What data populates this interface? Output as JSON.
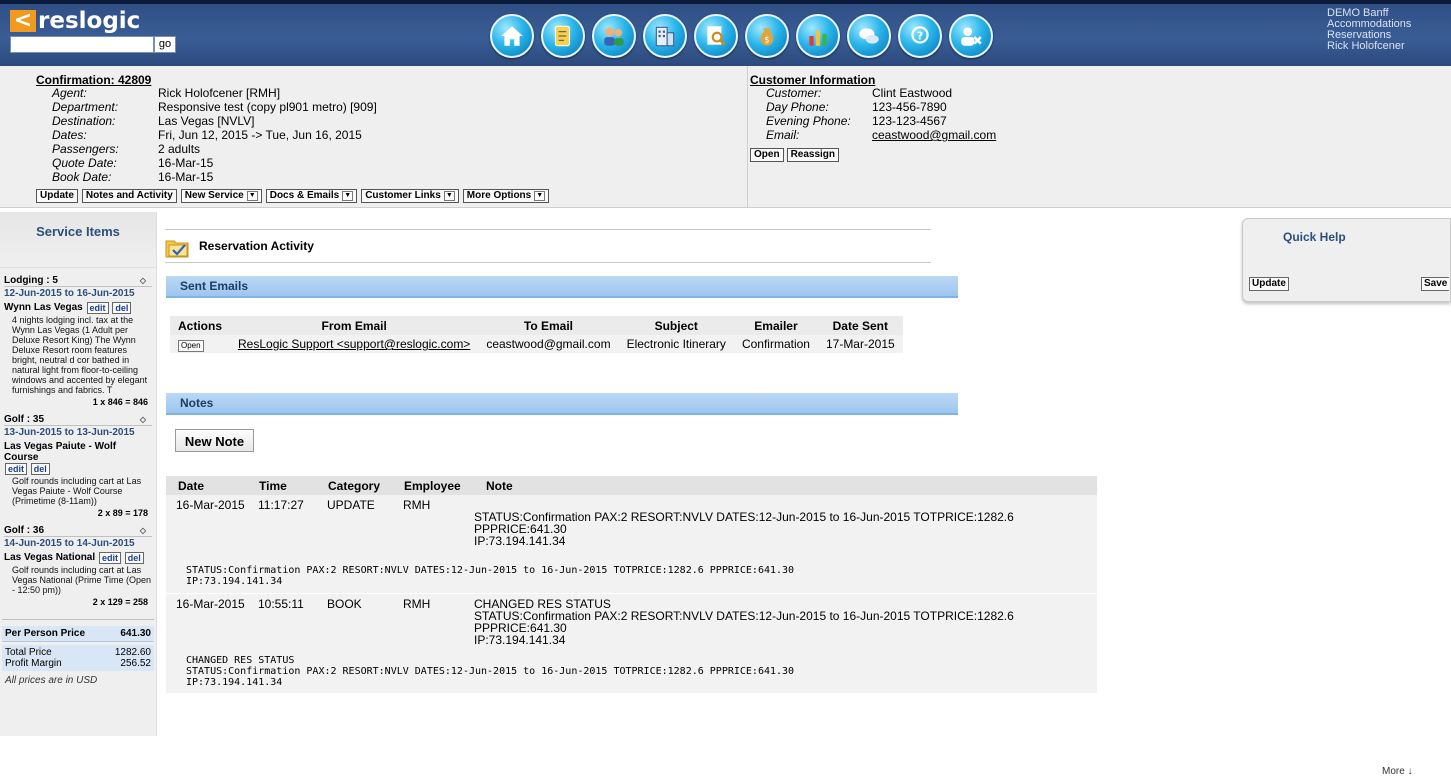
{
  "header": {
    "logo_text": "reslogic",
    "search_placeholder": "",
    "go_label": "go",
    "nav_icons": [
      "home-icon",
      "notes-icon",
      "customers-icon",
      "suppliers-icon",
      "search-icon",
      "money-icon",
      "reports-icon",
      "chat-icon",
      "help-icon",
      "logout-icon"
    ],
    "user_info": [
      "DEMO Banff",
      "Accommodations",
      "Reservations",
      "Rick Holofcener"
    ]
  },
  "confirmation": {
    "title": "Confirmation: 42809",
    "rows": [
      {
        "label": "Agent:",
        "value": "Rick Holofcener [RMH]"
      },
      {
        "label": "Department:",
        "value": "Responsive test (copy pl901 metro) [909]"
      },
      {
        "label": "Destination:",
        "value": "Las Vegas [NVLV]"
      },
      {
        "label": "Dates:",
        "value": "Fri, Jun 12, 2015 -> Tue, Jun 16, 2015"
      },
      {
        "label": "Passengers:",
        "value": "2 adults"
      },
      {
        "label": "Quote Date:",
        "value": "16-Mar-15"
      },
      {
        "label": "Book Date:",
        "value": "16-Mar-15"
      }
    ],
    "buttons": {
      "update": "Update",
      "notes": "Notes and Activity",
      "new_service": "New Service",
      "docs": "Docs & Emails",
      "customer_links": "Customer Links",
      "more_options": "More Options"
    }
  },
  "customer": {
    "title": "Customer Information",
    "rows": [
      {
        "label": "Customer:",
        "value": "Clint Eastwood"
      },
      {
        "label": "Day Phone:",
        "value": "123-456-7890"
      },
      {
        "label": "Evening Phone:",
        "value": "123-123-4567"
      },
      {
        "label": "Email:",
        "value": "ceastwood@gmail.com"
      }
    ],
    "open_label": "Open",
    "reassign_label": "Reassign"
  },
  "sidebar": {
    "title": "Service Items",
    "services": [
      {
        "head": "Lodging : 5",
        "dates": "12-Jun-2015 to 16-Jun-2015",
        "name": "Wynn Las Vegas",
        "desc": "4 nights lodging incl. tax at the Wynn Las Vegas (1 Adult per Deluxe Resort King) The Wynn Deluxe Resort room features bright, neutral d cor bathed in natural light from floor-to-ceiling windows and accented by elegant furnishings and fabrics. T",
        "price": "1 x 846 = 846"
      },
      {
        "head": "Golf : 35",
        "dates": "13-Jun-2015 to 13-Jun-2015",
        "name": "Las Vegas Paiute - Wolf Course",
        "desc": "Golf rounds including cart at Las Vegas Paiute - Wolf Course (Primetime (8-11am))",
        "price": "2 x 89 = 178"
      },
      {
        "head": "Golf : 36",
        "dates": "14-Jun-2015 to 14-Jun-2015",
        "name": "Las Vegas National",
        "desc": "Golf rounds including cart at Las Vegas National (Prime Time (Open - 12:50 pm))",
        "price": "2 x 129 = 258"
      }
    ],
    "edit_label": "edit",
    "del_label": "del",
    "per_person_label": "Per Person Price",
    "per_person_value": "641.30",
    "total_label": "Total Price",
    "total_value": "1282.60",
    "margin_label": "Profit Margin",
    "margin_value": "256.52",
    "usd_note": "All prices are in USD"
  },
  "activity": {
    "title": "Reservation Activity",
    "sent_emails_title": "Sent Emails",
    "email_columns": [
      "Actions",
      "From Email",
      "To Email",
      "Subject",
      "Emailer",
      "Date Sent"
    ],
    "emails": [
      {
        "action": "Open",
        "from": "ResLogic Support <support@reslogic.com>",
        "to": "ceastwood@gmail.com",
        "subject": "Electronic Itinerary",
        "emailer": "Confirmation",
        "date": "17-Mar-2015"
      }
    ],
    "notes_title": "Notes",
    "new_note_label": "New Note",
    "note_columns": [
      "Date",
      "Time",
      "Category",
      "Employee",
      "Note"
    ],
    "notes": [
      {
        "date": "16-Mar-2015",
        "time": "11:17:27",
        "category": "UPDATE",
        "employee": "RMH",
        "note_line1": "",
        "note_line2": "STATUS:Confirmation PAX:2 RESORT:NVLV DATES:12-Jun-2015 to 16-Jun-2015 TOTPRICE:1282.6 PPPRICE:641.30",
        "note_line3": "IP:73.194.141.34",
        "detail_line1": "",
        "detail_line2": "STATUS:Confirmation PAX:2 RESORT:NVLV DATES:12-Jun-2015 to 16-Jun-2015 TOTPRICE:1282.6 PPPRICE:641.30",
        "detail_line3": "IP:73.194.141.34"
      },
      {
        "date": "16-Mar-2015",
        "time": "10:55:11",
        "category": "BOOK",
        "employee": "RMH",
        "note_line1": "CHANGED RES STATUS",
        "note_line2": "STATUS:Confirmation PAX:2 RESORT:NVLV DATES:12-Jun-2015 to 16-Jun-2015 TOTPRICE:1282.6 PPPRICE:641.30",
        "note_line3": "IP:73.194.141.34",
        "detail_line1": "CHANGED RES STATUS",
        "detail_line2": "STATUS:Confirmation PAX:2 RESORT:NVLV DATES:12-Jun-2015 to 16-Jun-2015 TOTPRICE:1282.6 PPPRICE:641.30",
        "detail_line3": "IP:73.194.141.34"
      }
    ]
  },
  "quick_help": {
    "title": "Quick Help",
    "update_label": "Update",
    "save_label": "Save"
  },
  "footer": {
    "scroll_hint": "More ↓"
  }
}
